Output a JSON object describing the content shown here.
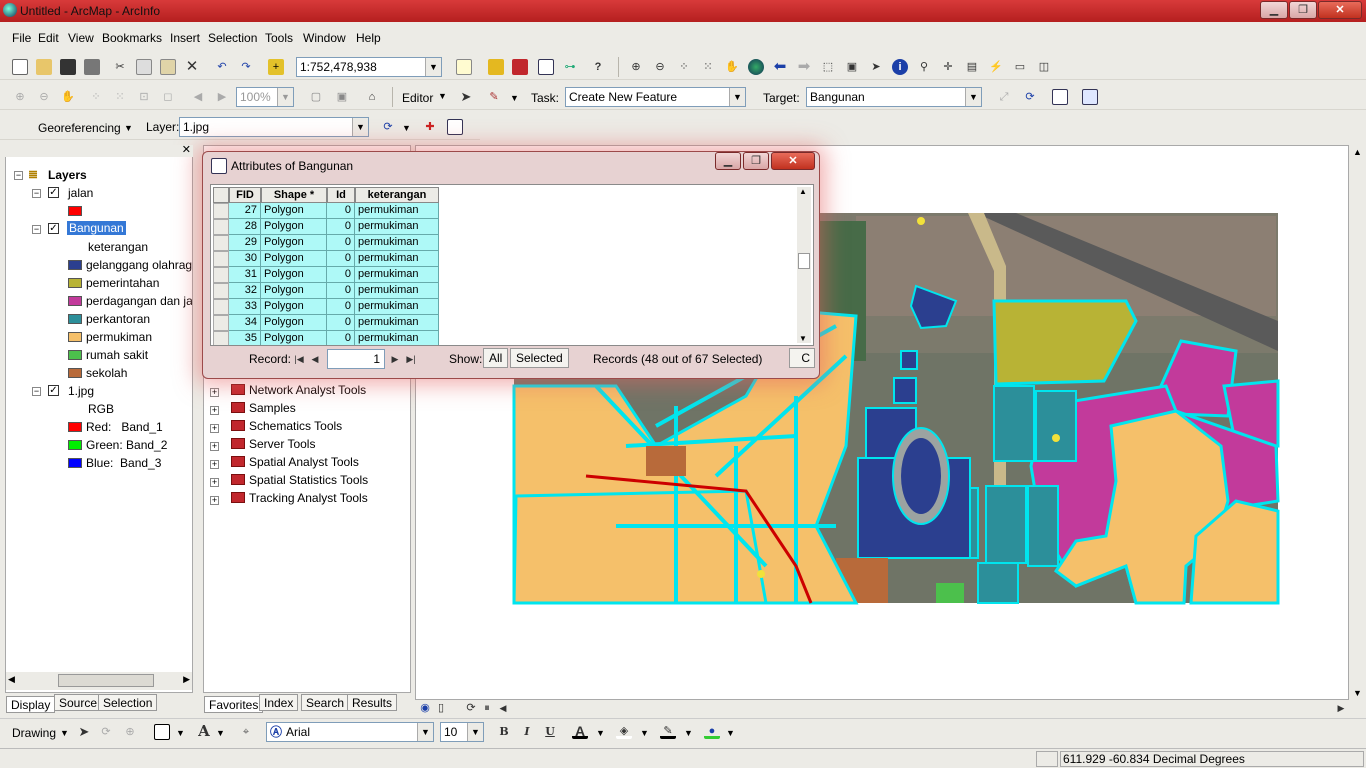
{
  "window": {
    "title": "Untitled - ArcMap - ArcInfo",
    "minimize": "▁",
    "maximize": "❐",
    "close": "✕"
  },
  "menu": [
    "File",
    "Edit",
    "View",
    "Bookmarks",
    "Insert",
    "Selection",
    "Tools",
    "Window",
    "Help"
  ],
  "standard_toolbar": {
    "scale": "1:752,478,938",
    "zoom_percent": "100%"
  },
  "editor_toolbar": {
    "editor_label": "Editor",
    "task_label": "Task:",
    "task_value": "Create New Feature",
    "target_label": "Target:",
    "target_value": "Bangunan"
  },
  "georef_toolbar": {
    "georef_label": "Georeferencing",
    "layer_label": "Layer:",
    "layer_value": "1.jpg"
  },
  "toc": {
    "root": "Layers",
    "layers": [
      {
        "name": "jalan",
        "symbols": [
          {
            "label": "",
            "color": "#ff0000"
          }
        ]
      },
      {
        "name": "Bangunan",
        "field": "keterangan",
        "symbols": [
          {
            "label": "gelanggang olahrag",
            "color": "#2b3f8f"
          },
          {
            "label": "pemerintahan",
            "color": "#b8b335"
          },
          {
            "label": "perdagangan dan ja",
            "color": "#c23a9b"
          },
          {
            "label": "perkantoran",
            "color": "#2c8f9a"
          },
          {
            "label": "permukiman",
            "color": "#f5c06a"
          },
          {
            "label": "rumah sakit",
            "color": "#4cc04c"
          },
          {
            "label": "sekolah",
            "color": "#b86a3a"
          }
        ]
      },
      {
        "name": "1.jpg",
        "field": "RGB",
        "symbols": [
          {
            "label": "Red:   Band_1",
            "color": "#ff0000"
          },
          {
            "label": "Green: Band_2",
            "color": "#00ee00"
          },
          {
            "label": "Blue:  Band_3",
            "color": "#0000ff"
          }
        ]
      }
    ],
    "tabs": [
      "Display",
      "Source",
      "Selection"
    ]
  },
  "catalog": {
    "tools": [
      "Network Analyst Tools",
      "Samples",
      "Schematics Tools",
      "Server Tools",
      "Spatial Analyst Tools",
      "Spatial Statistics Tools",
      "Tracking Analyst Tools"
    ],
    "tabs": [
      "Favorites",
      "Index",
      "Search",
      "Results"
    ]
  },
  "attributes": {
    "title": "Attributes of Bangunan",
    "columns": [
      "FID",
      "Shape *",
      "Id",
      "keterangan"
    ],
    "rows": [
      [
        "27",
        "Polygon",
        "0",
        "permukiman"
      ],
      [
        "28",
        "Polygon",
        "0",
        "permukiman"
      ],
      [
        "29",
        "Polygon",
        "0",
        "permukiman"
      ],
      [
        "30",
        "Polygon",
        "0",
        "permukiman"
      ],
      [
        "31",
        "Polygon",
        "0",
        "permukiman"
      ],
      [
        "32",
        "Polygon",
        "0",
        "permukiman"
      ],
      [
        "33",
        "Polygon",
        "0",
        "permukiman"
      ],
      [
        "34",
        "Polygon",
        "0",
        "permukiman"
      ],
      [
        "35",
        "Polygon",
        "0",
        "permukiman"
      ]
    ],
    "record_label": "Record:",
    "record_value": "1",
    "show_label": "Show:",
    "show_all": "All",
    "show_selected": "Selected",
    "records_text": "Records (48 out of 67 Selected)",
    "options_cut": "C"
  },
  "drawing_toolbar": {
    "drawing_label": "Drawing",
    "font": "Arial",
    "font_size": "10",
    "bold": "B",
    "italic": "I",
    "underline": "U",
    "text_tool": "A"
  },
  "status": {
    "coordinates": "611.929  -60.834 Decimal Degrees"
  }
}
